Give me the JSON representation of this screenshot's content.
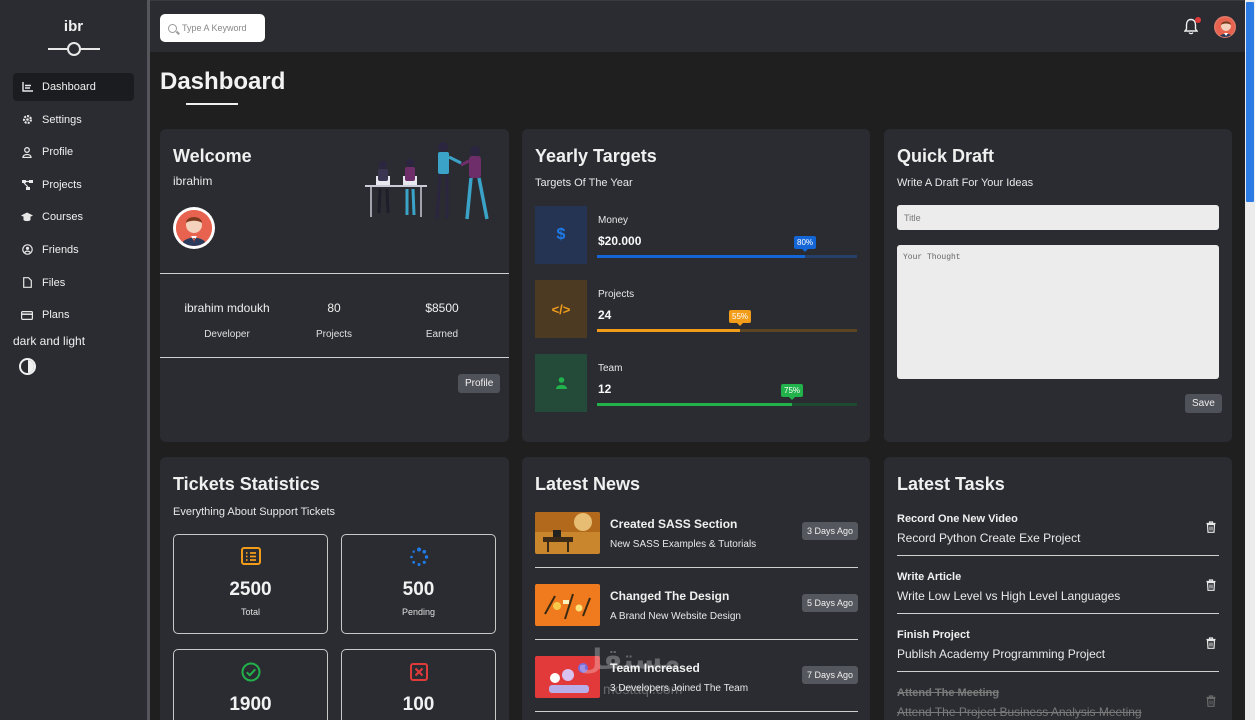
{
  "sidebar": {
    "logo": "ibr",
    "items": [
      {
        "label": "Dashboard",
        "icon": "chart-line-icon",
        "active": true
      },
      {
        "label": "Settings",
        "icon": "gear-icon"
      },
      {
        "label": "Profile",
        "icon": "user-icon"
      },
      {
        "label": "Projects",
        "icon": "diagram-project-icon"
      },
      {
        "label": "Courses",
        "icon": "graduation-cap-icon"
      },
      {
        "label": "Friends",
        "icon": "circle-user-icon"
      },
      {
        "label": "Files",
        "icon": "file-icon"
      },
      {
        "label": "Plans",
        "icon": "credit-card-icon"
      }
    ],
    "theme_label": "dark and light"
  },
  "topbar": {
    "search_placeholder": "Type A Keyword",
    "notification_icon": "bell-icon",
    "has_notification": true
  },
  "page": {
    "title": "Dashboard"
  },
  "welcome": {
    "title": "Welcome",
    "user": "ibrahim",
    "stats": [
      {
        "value": "ibrahim mdoukh",
        "label": "Developer"
      },
      {
        "value": "80",
        "label": "Projects"
      },
      {
        "value": "$8500",
        "label": "Earned"
      }
    ],
    "profile_button": "Profile"
  },
  "targets": {
    "title": "Yearly Targets",
    "subtitle": "Targets Of The Year",
    "items": [
      {
        "label": "Money",
        "value": "$20.000",
        "percent": 80,
        "percent_label": "80%",
        "color": "#1466d6",
        "icon": "dollar-icon",
        "icon_text": "$"
      },
      {
        "label": "Projects",
        "value": "24",
        "percent": 55,
        "percent_label": "55%",
        "color": "#f29d1a",
        "icon": "code-icon",
        "icon_text": "</>"
      },
      {
        "label": "Team",
        "value": "12",
        "percent": 75,
        "percent_label": "75%",
        "color": "#22b24c",
        "icon": "user-icon",
        "icon_text": ""
      }
    ]
  },
  "draft": {
    "title": "Quick Draft",
    "subtitle": "Write A Draft For Your Ideas",
    "title_placeholder": "Title",
    "text_placeholder": "Your Thought",
    "save_button": "Save"
  },
  "tickets": {
    "title": "Tickets Statistics",
    "subtitle": "Everything About Support Tickets",
    "items": [
      {
        "value": "2500",
        "label": "Total",
        "icon": "list-icon",
        "color": "#f29d1a"
      },
      {
        "value": "500",
        "label": "Pending",
        "icon": "spinner-icon",
        "color": "#1e7be8"
      },
      {
        "value": "1900",
        "label": "",
        "icon": "check-circle-icon",
        "color": "#22b24c"
      },
      {
        "value": "100",
        "label": "",
        "icon": "x-square-icon",
        "color": "#e03b3b"
      }
    ]
  },
  "news": {
    "title": "Latest News",
    "items": [
      {
        "title": "Created SASS Section",
        "desc": "New SASS Examples & Tutorials",
        "badge": "3 Days Ago"
      },
      {
        "title": "Changed The Design",
        "desc": "A Brand New Website Design",
        "badge": "5 Days Ago"
      },
      {
        "title": "Team Increased",
        "desc": "3 Developers Joined The Team",
        "badge": "7 Days Ago"
      }
    ]
  },
  "tasks": {
    "title": "Latest Tasks",
    "items": [
      {
        "title": "Record One New Video",
        "desc": "Record Python Create Exe Project",
        "done": false
      },
      {
        "title": "Write Article",
        "desc": "Write Low Level vs High Level Languages",
        "done": false
      },
      {
        "title": "Finish Project",
        "desc": "Publish Academy Programming Project",
        "done": false
      },
      {
        "title": "Attend The Meeting",
        "desc": "Attend The Project Business Analysis Meeting",
        "done": true
      }
    ]
  },
  "watermark": {
    "text": "مستقل",
    "sub": "mostaql.com"
  }
}
